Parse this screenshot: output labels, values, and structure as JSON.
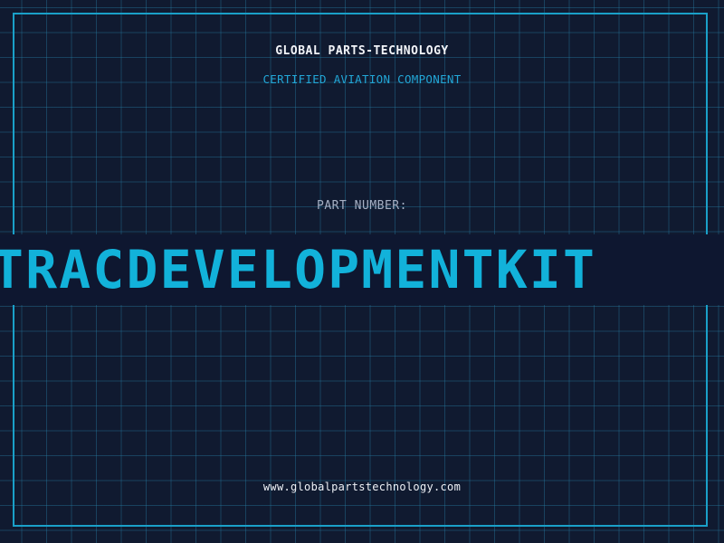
{
  "header": {
    "company_name": "GLOBAL PARTS-TECHNOLOGY",
    "tagline": "CERTIFIED AVIATION COMPONENT"
  },
  "part": {
    "label": "PART NUMBER:",
    "number": "TRACDEVELOPMENTKIT"
  },
  "footer": {
    "website": "www.globalpartstechnology.com"
  },
  "colors": {
    "background": "#101a30",
    "grid": "#2882aa",
    "accent": "#12b2da",
    "text": "#f2f4f8"
  }
}
